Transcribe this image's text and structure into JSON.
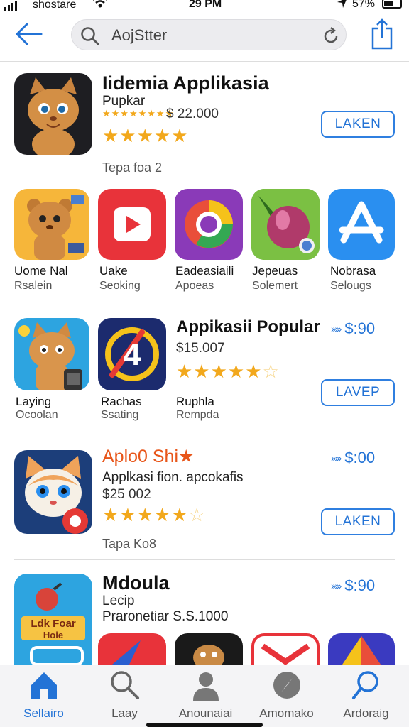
{
  "status": {
    "carrier": "shostare",
    "time": "29 PM",
    "battery": "57%"
  },
  "search": {
    "value": "AojStter"
  },
  "featured": {
    "title": "Iidemia Applikasia",
    "subtitle": "Pupkar",
    "price": "$ 22.000",
    "meta": "Tepa foa 2",
    "button": "LAKEN",
    "rating_small": 5,
    "rating": 5
  },
  "row1": [
    {
      "name": "Uome Nal",
      "sub": "Rsalein",
      "icon": "bear-character-icon"
    },
    {
      "name": "Uake",
      "sub": "Seoking",
      "icon": "youtube-play-icon"
    },
    {
      "name": "Eadeasiaili",
      "sub": "Apoeas",
      "icon": "chrome-ring-icon"
    },
    {
      "name": "Jepeuas",
      "sub": "Solemert",
      "icon": "berry-fruit-icon"
    },
    {
      "name": "Nobrasa",
      "sub": "Selougs",
      "icon": "app-store-a-icon"
    }
  ],
  "popular": {
    "title": "Appikasii Popular",
    "price": "$15.007",
    "link_price": "$:90",
    "button": "LAVEP",
    "rating": 4.5,
    "tiles": [
      {
        "name": "Laying",
        "sub": "Ocoolan",
        "icon": "cat-phone-icon"
      },
      {
        "name": "Rachas",
        "sub": "Ssating",
        "icon": "number-four-icon"
      },
      {
        "name": "Ruphla",
        "sub": "Rempda"
      }
    ]
  },
  "app3": {
    "title": "Aplo0 Shi★",
    "link_price": "$:00",
    "subtitle": "Applkasi fion. apcokafis",
    "price": "$25 002",
    "rating": 4.5,
    "meta": "Tapa Ko8",
    "button": "LAKEN",
    "icon": "cartoon-cat-icon"
  },
  "app4": {
    "title": "Mdoula",
    "link_price": "$:90",
    "sub1": "Lecip",
    "sub2": "Praronetiar  S.S.1000",
    "icon_text_1": "Ldk Foar",
    "icon_text_2": "Hoie"
  },
  "tabs": [
    {
      "label": "Sellairo",
      "icon": "home-icon",
      "active": true
    },
    {
      "label": "Laay",
      "icon": "search-icon"
    },
    {
      "label": "Anounaiai",
      "icon": "person-icon"
    },
    {
      "label": "Amomako",
      "icon": "compass-icon"
    },
    {
      "label": "Ardoraig",
      "icon": "magnifier-icon"
    }
  ],
  "colors": {
    "accent": "#2373d6",
    "star": "#f2a81c",
    "orange_title": "#e8561a"
  }
}
